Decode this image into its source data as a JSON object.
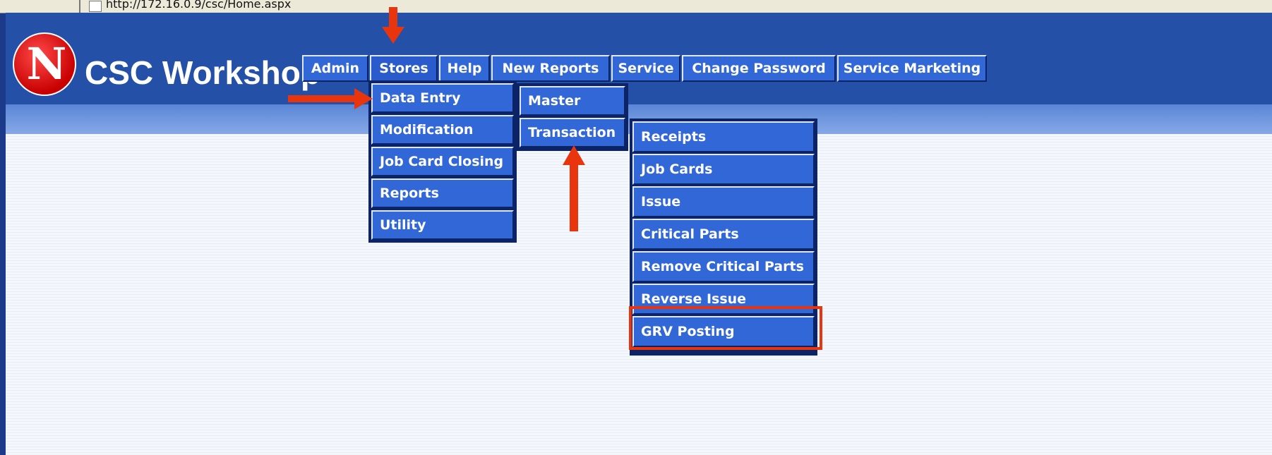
{
  "browser": {
    "address_url": "http://172.16.0.9/csc/Home.aspx"
  },
  "header": {
    "logo_letter": "N",
    "title": "CSC Workshop"
  },
  "nav": {
    "tabs": [
      "Admin",
      "Stores",
      "Help",
      "New Reports",
      "Service",
      "Change Password",
      "Service Marketing"
    ]
  },
  "stores_menu": {
    "items": [
      "Data Entry",
      "Modification",
      "Job Card Closing",
      "Reports",
      "Utility"
    ]
  },
  "data_entry_menu": {
    "items": [
      "Master",
      "Transaction"
    ]
  },
  "transaction_menu": {
    "items": [
      "Receipts",
      "Job Cards",
      "Issue",
      "Critical Parts",
      "Remove Critical Parts",
      "Reverse Issue",
      "GRV Posting"
    ]
  },
  "annotations": {
    "accent_color": "#e8350e",
    "highlighted_item": "GRV Posting"
  }
}
